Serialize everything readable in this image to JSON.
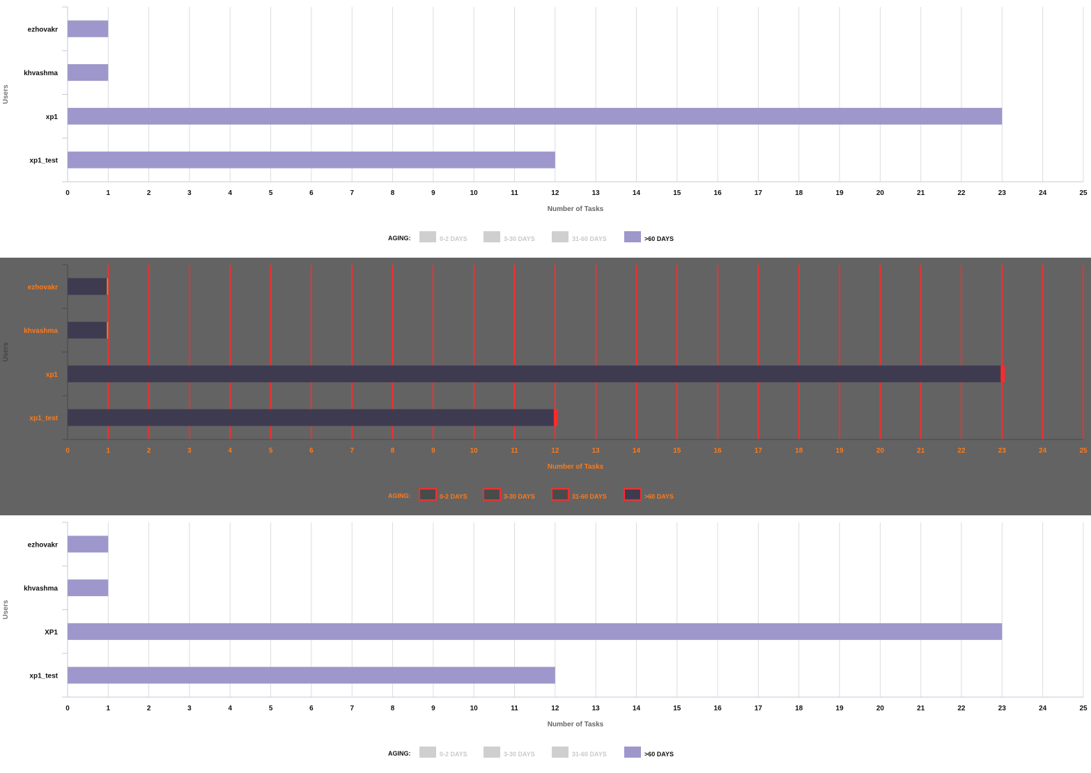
{
  "panels": [
    {
      "chart_data": {
        "type": "bar",
        "orientation": "horizontal",
        "categories": [
          "ezhovakr",
          "khvashma",
          "xp1",
          "xp1_test"
        ],
        "series": [
          {
            "name": "0-2 DAYS",
            "values": [
              0,
              0,
              0,
              0
            ]
          },
          {
            "name": "3-30 DAYS",
            "values": [
              0,
              0,
              0,
              0
            ]
          },
          {
            "name": "31-60 DAYS",
            "values": [
              0,
              0,
              0,
              0
            ]
          },
          {
            "name": ">60 DAYS",
            "values": [
              1,
              1,
              23,
              12
            ]
          }
        ],
        "xlabel": "Number of Tasks",
        "ylabel": "Users",
        "xlim": [
          0,
          25
        ],
        "xticks": [
          0,
          1,
          2,
          3,
          4,
          5,
          6,
          7,
          8,
          9,
          10,
          11,
          12,
          13,
          14,
          15,
          16,
          17,
          18,
          19,
          20,
          21,
          22,
          23,
          24,
          25
        ],
        "grid": true,
        "stacked": true,
        "legend": {
          "title": "AGING:",
          "placement": "bottom-center",
          "active": [
            ">60 DAYS"
          ]
        }
      }
    },
    {
      "chart_data": {
        "type": "bar",
        "orientation": "horizontal",
        "categories": [
          "ezhovakr",
          "khvashma",
          "xp1",
          "xp1_test"
        ],
        "series": [
          {
            "name": "0-2 DAYS",
            "values": [
              0,
              0,
              0,
              0
            ]
          },
          {
            "name": "3-30 DAYS",
            "values": [
              0,
              0,
              0,
              0
            ]
          },
          {
            "name": "31-60 DAYS",
            "values": [
              0,
              0,
              0,
              0
            ]
          },
          {
            "name": ">60 DAYS",
            "values": [
              1,
              1,
              23,
              12
            ]
          }
        ],
        "xlabel": "Number of Tasks",
        "ylabel": "Users",
        "xlim": [
          0,
          25
        ],
        "xticks": [
          0,
          1,
          2,
          3,
          4,
          5,
          6,
          7,
          8,
          9,
          10,
          11,
          12,
          13,
          14,
          15,
          16,
          17,
          18,
          19,
          20,
          21,
          22,
          23,
          24,
          25
        ],
        "grid": true,
        "stacked": true,
        "legend": {
          "title": "AGING:",
          "placement": "bottom-center",
          "active": [
            ">60 DAYS"
          ]
        }
      }
    },
    {
      "chart_data": {
        "type": "bar",
        "orientation": "horizontal",
        "categories": [
          "ezhovakr",
          "khvashma",
          "XP1",
          "xp1_test"
        ],
        "series": [
          {
            "name": "0-2 DAYS",
            "values": [
              0,
              0,
              0,
              0
            ]
          },
          {
            "name": "3-30 DAYS",
            "values": [
              0,
              0,
              0,
              0
            ]
          },
          {
            "name": "31-60 DAYS",
            "values": [
              0,
              0,
              0,
              0
            ]
          },
          {
            "name": ">60 DAYS",
            "values": [
              1,
              1,
              23,
              12
            ]
          }
        ],
        "xlabel": "Number of Tasks",
        "ylabel": "Users",
        "xlim": [
          0,
          25
        ],
        "xticks": [
          0,
          1,
          2,
          3,
          4,
          5,
          6,
          7,
          8,
          9,
          10,
          11,
          12,
          13,
          14,
          15,
          16,
          17,
          18,
          19,
          20,
          21,
          22,
          23,
          24,
          25
        ],
        "grid": true,
        "stacked": true,
        "legend": {
          "title": "AGING:",
          "placement": "bottom-center",
          "active": [
            ">60 DAYS"
          ]
        }
      }
    }
  ],
  "themes": {
    "normal": {
      "bar": "#9e97cb",
      "grid": "#dcdcdc",
      "axis": "#c4cad8",
      "label": "#111111",
      "ytitle": "#777777",
      "xtitle": "#666666",
      "legend_inactive": "#cfcfcf",
      "legend_text_active": "#111111",
      "legend_text_inactive": "#c9c9c9"
    },
    "diff": {
      "bar": "#3e3b51",
      "grid": "#ff2a2a",
      "axis": "#4a4a4a",
      "label": "#ff7a1a",
      "ytitle": "#444444",
      "xtitle": "#ff7a1a",
      "legend_inactive": "#4a4a4a",
      "legend_text_active": "#ff7a1a",
      "legend_text_inactive": "#ff7a1a",
      "highlight": "#ff2a2a"
    }
  }
}
